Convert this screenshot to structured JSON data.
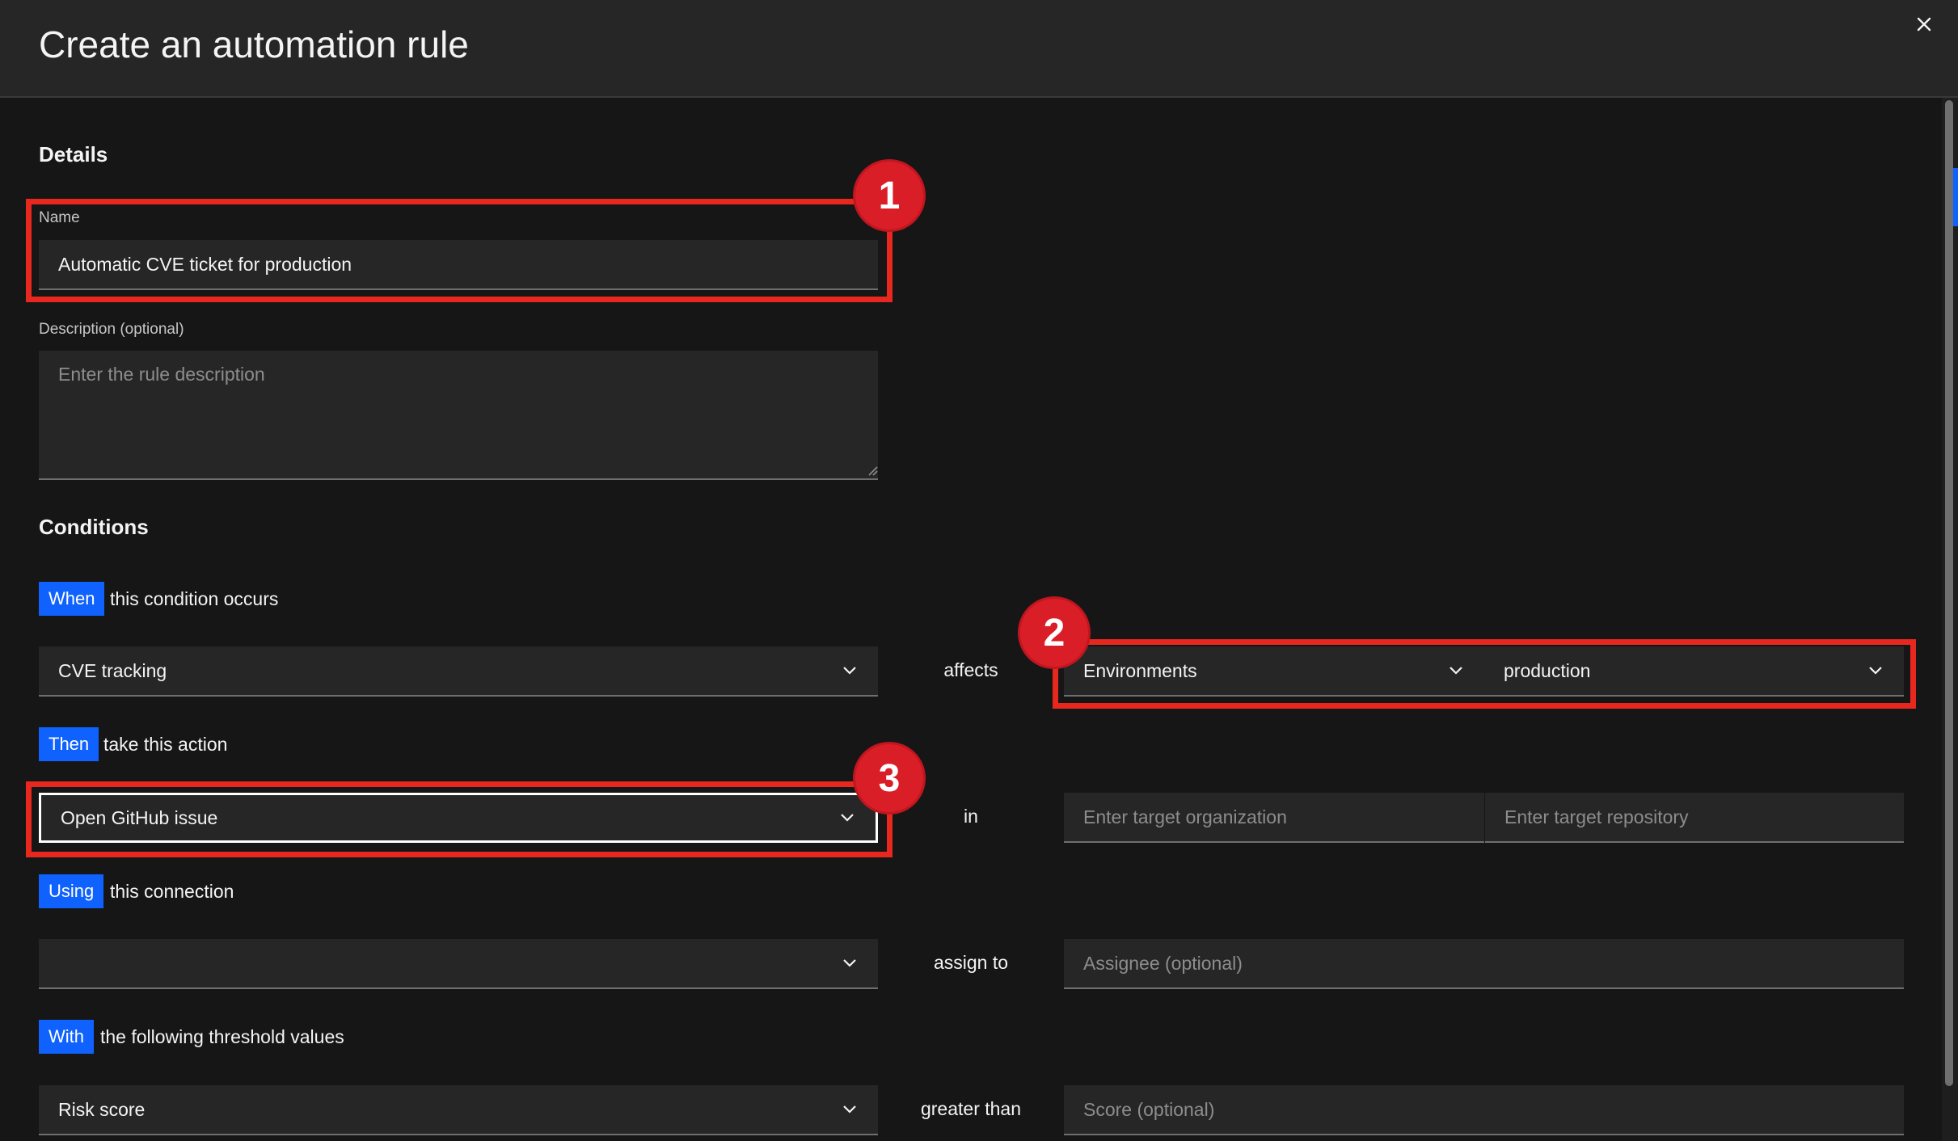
{
  "modal": {
    "title": "Create an automation rule"
  },
  "details": {
    "heading": "Details",
    "name_label": "Name",
    "name_value": "Automatic CVE ticket for production",
    "description_label": "Description (optional)",
    "description_placeholder": "Enter the rule description"
  },
  "conditions": {
    "heading": "Conditions",
    "when_tag": "When",
    "when_text": "this condition occurs",
    "condition_select": "CVE tracking",
    "affects_label": "affects",
    "scope_select": "Environments",
    "environment_select": "production",
    "then_tag": "Then",
    "then_text": "take this action",
    "action_select": "Open GitHub issue",
    "in_label": "in",
    "org_placeholder": "Enter target organization",
    "repo_placeholder": "Enter target repository",
    "using_tag": "Using",
    "using_text": "this connection",
    "connection_select": "",
    "assign_label": "assign to",
    "assignee_placeholder": "Assignee (optional)",
    "with_tag": "With",
    "with_text": "the following threshold values",
    "threshold_select": "Risk score",
    "greater_label": "greater than",
    "score_placeholder": "Score (optional)"
  },
  "callouts": [
    "1",
    "2",
    "3"
  ],
  "colors": {
    "background": "#161616",
    "field": "#262626",
    "tag": "#0f62fe",
    "highlight": "#e8281f",
    "callout": "#da1e28"
  },
  "icons": {
    "close": "close-icon",
    "dropdown": "chevron-down-icon"
  }
}
